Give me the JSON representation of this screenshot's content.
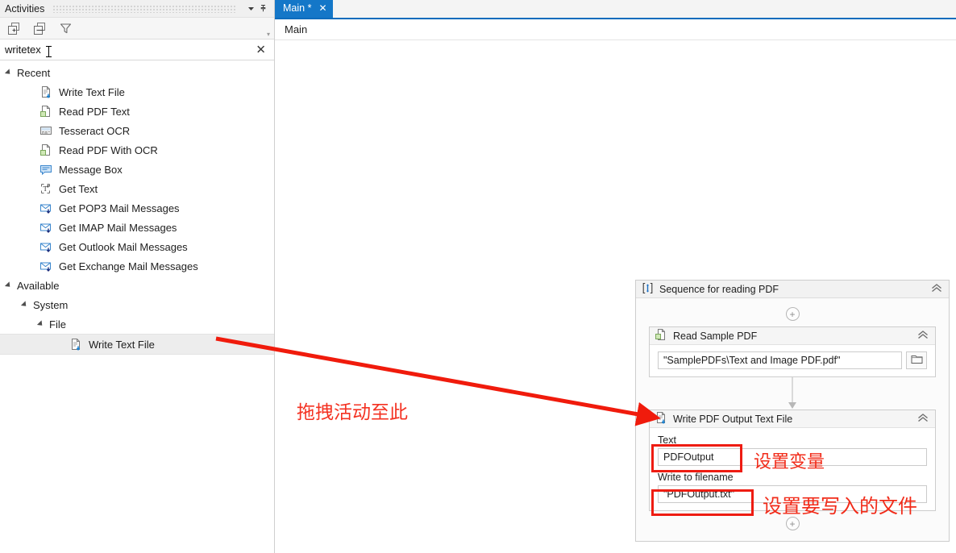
{
  "panel": {
    "title": "Activities",
    "dropdown_icon": "chevron-down-icon",
    "pin_icon": "pin-icon",
    "toolbar": {
      "expand_all": "expand-all-icon",
      "collapse_all": "collapse-all-icon",
      "filter": "filter-icon",
      "overflow": "▾"
    },
    "search": {
      "value": "writetex",
      "clear_label": "✕"
    }
  },
  "tree": {
    "recent": {
      "label": "Recent",
      "items": [
        {
          "label": "Write Text File",
          "icon": "document-write-icon"
        },
        {
          "label": "Read PDF Text",
          "icon": "document-read-icon"
        },
        {
          "label": "Tesseract OCR",
          "icon": "ocr-screen-icon"
        },
        {
          "label": "Read PDF With OCR",
          "icon": "document-read-icon"
        },
        {
          "label": "Message Box",
          "icon": "message-box-icon"
        },
        {
          "label": "Get Text",
          "icon": "get-text-icon"
        },
        {
          "label": "Get POP3 Mail Messages",
          "icon": "mail-download-icon"
        },
        {
          "label": "Get IMAP Mail Messages",
          "icon": "mail-download-icon"
        },
        {
          "label": "Get Outlook Mail Messages",
          "icon": "mail-download-icon"
        },
        {
          "label": "Get Exchange Mail Messages",
          "icon": "mail-download-icon"
        }
      ]
    },
    "available": {
      "label": "Available",
      "system": {
        "label": "System"
      },
      "file": {
        "label": "File"
      },
      "selected_item": {
        "label": "Write Text File",
        "icon": "document-write-icon"
      }
    }
  },
  "designer": {
    "tab": {
      "label": "Main *",
      "close_label": "✕"
    },
    "breadcrumb": "Main"
  },
  "workflow": {
    "sequence": {
      "title": "Sequence for reading PDF",
      "icon": "sequence-icon",
      "collapse_label": "⌃",
      "add_top_label": "+",
      "add_bottom_label": "+"
    },
    "read_activity": {
      "title": "Read Sample PDF",
      "icon": "document-read-icon",
      "collapse_label": "⌃",
      "path_value": "\"SamplePDFs\\Text and Image PDF.pdf\"",
      "browse_icon": "folder-icon"
    },
    "write_activity": {
      "title": "Write PDF Output Text File",
      "icon": "document-write-icon",
      "collapse_label": "⌃",
      "text_label": "Text",
      "text_value": "PDFOutput",
      "filename_label": "Write to filename",
      "filename_value": "\"PDFOutput.txt\""
    }
  },
  "annotations": {
    "drag_here": "拖拽活动至此",
    "set_variable": "设置变量",
    "set_output_file": "设置要写入的文件",
    "accent_color": "#ee1c12"
  }
}
